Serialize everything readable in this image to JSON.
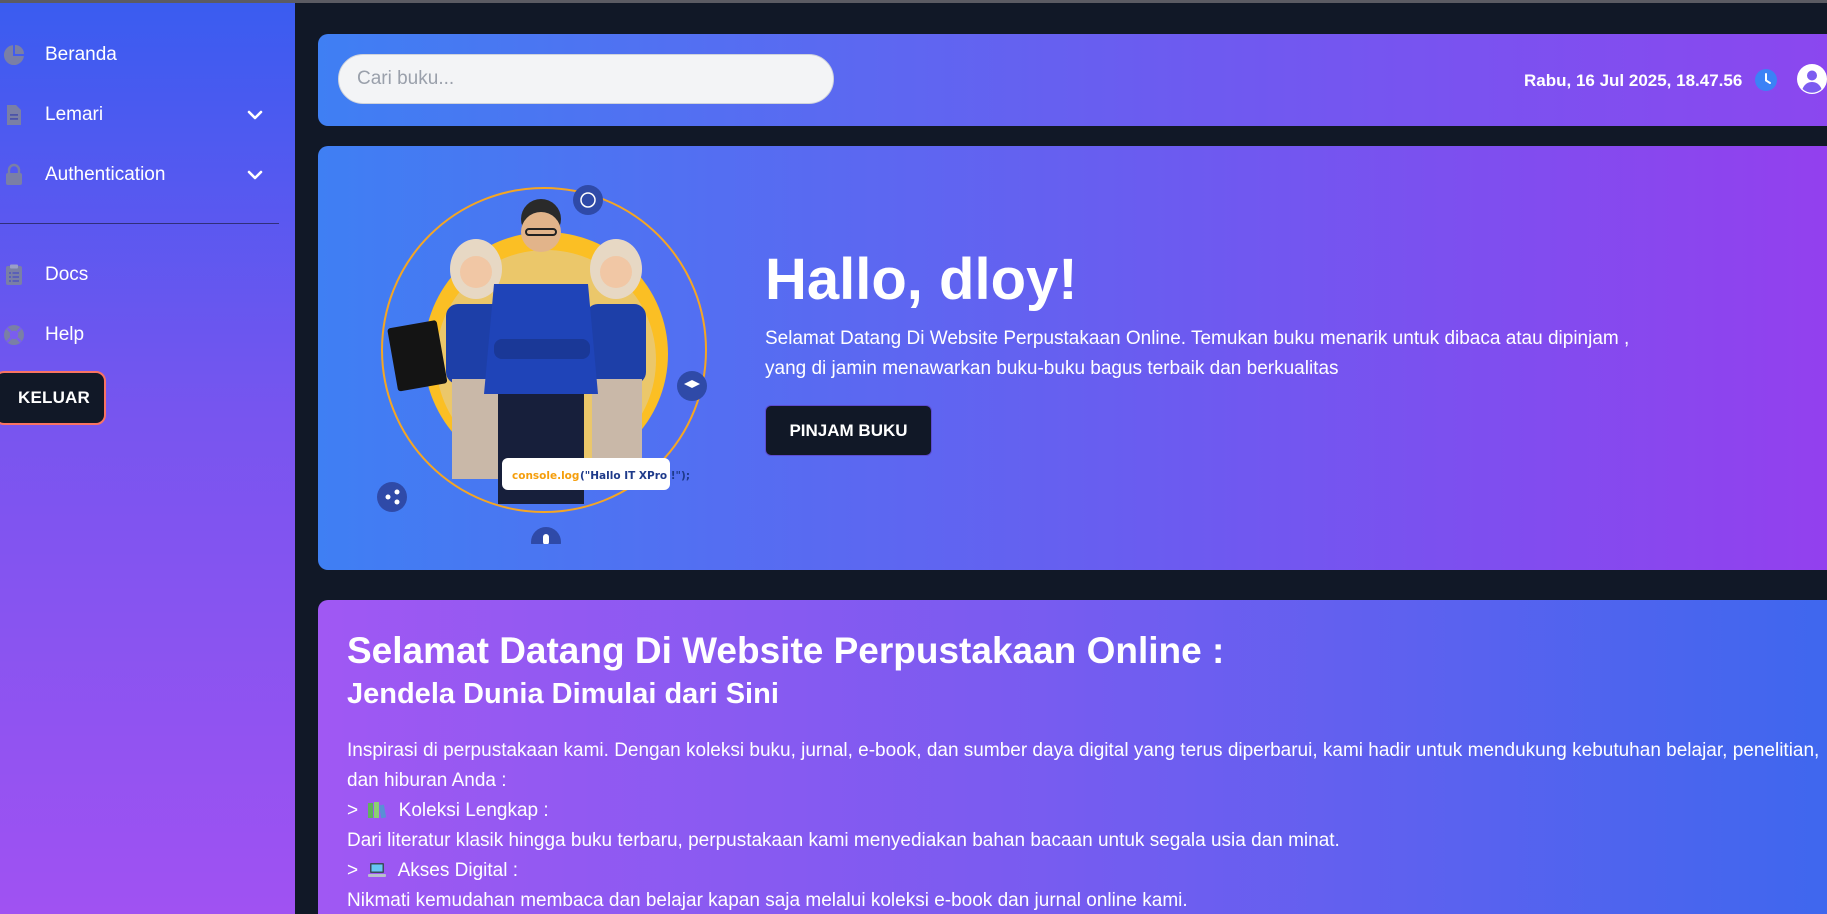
{
  "sidebar": {
    "items": [
      {
        "label": "Beranda",
        "icon": "pie-chart-icon"
      },
      {
        "label": "Lemari",
        "icon": "document-icon",
        "expandable": true
      },
      {
        "label": "Authentication",
        "icon": "lock-icon",
        "expandable": true
      },
      {
        "label": "Docs",
        "icon": "clipboard-icon"
      },
      {
        "label": "Help",
        "icon": "lifebuoy-icon"
      }
    ],
    "logout_label": "KELUAR"
  },
  "header": {
    "search_placeholder": "Cari buku...",
    "datetime": "Rabu, 16 Jul 2025, 18.47.56",
    "clock_icon": "clock-icon",
    "user_icon": "user-circle-icon"
  },
  "hero": {
    "title": "Hallo, dloy!",
    "text": "Selamat Datang Di Website Perpustakaan Online. Temukan buku menarik untuk dibaca atau dipinjam , yang di jamin menawarkan buku-buku bagus terbaik dan berkualitas",
    "button_label": "PINJAM BUKU",
    "illustration_caption_a": "console.log",
    "illustration_caption_b": "(\"Hallo IT XPro !\");"
  },
  "welcome": {
    "title": "Selamat Datang Di Website Perpustakaan Online :",
    "subtitle": "Jendela Dunia Dimulai dari Sini",
    "intro": "Inspirasi di perpustakaan kami. Dengan koleksi buku, jurnal, e-book, dan sumber daya digital yang terus diperbarui, kami hadir untuk mendukung kebutuhan belajar, penelitian, dan hiburan Anda :",
    "items": [
      {
        "marker": ">",
        "heading": "Koleksi Lengkap :",
        "icon": "books-icon",
        "text": "Dari literatur klasik hingga buku terbaru, perpustakaan kami menyediakan bahan bacaan untuk segala usia dan minat."
      },
      {
        "marker": ">",
        "heading": "Akses Digital :",
        "icon": "laptop-icon",
        "text": "Nikmati kemudahan membaca dan belajar kapan saja melalui koleksi e-book dan jurnal online kami."
      }
    ]
  },
  "colors": {
    "sidebar_top": "#3a5cf0",
    "sidebar_bottom": "#a052f2",
    "page_bg": "#111827",
    "logout_border": "#f97362",
    "clock": "#3b82f6"
  }
}
